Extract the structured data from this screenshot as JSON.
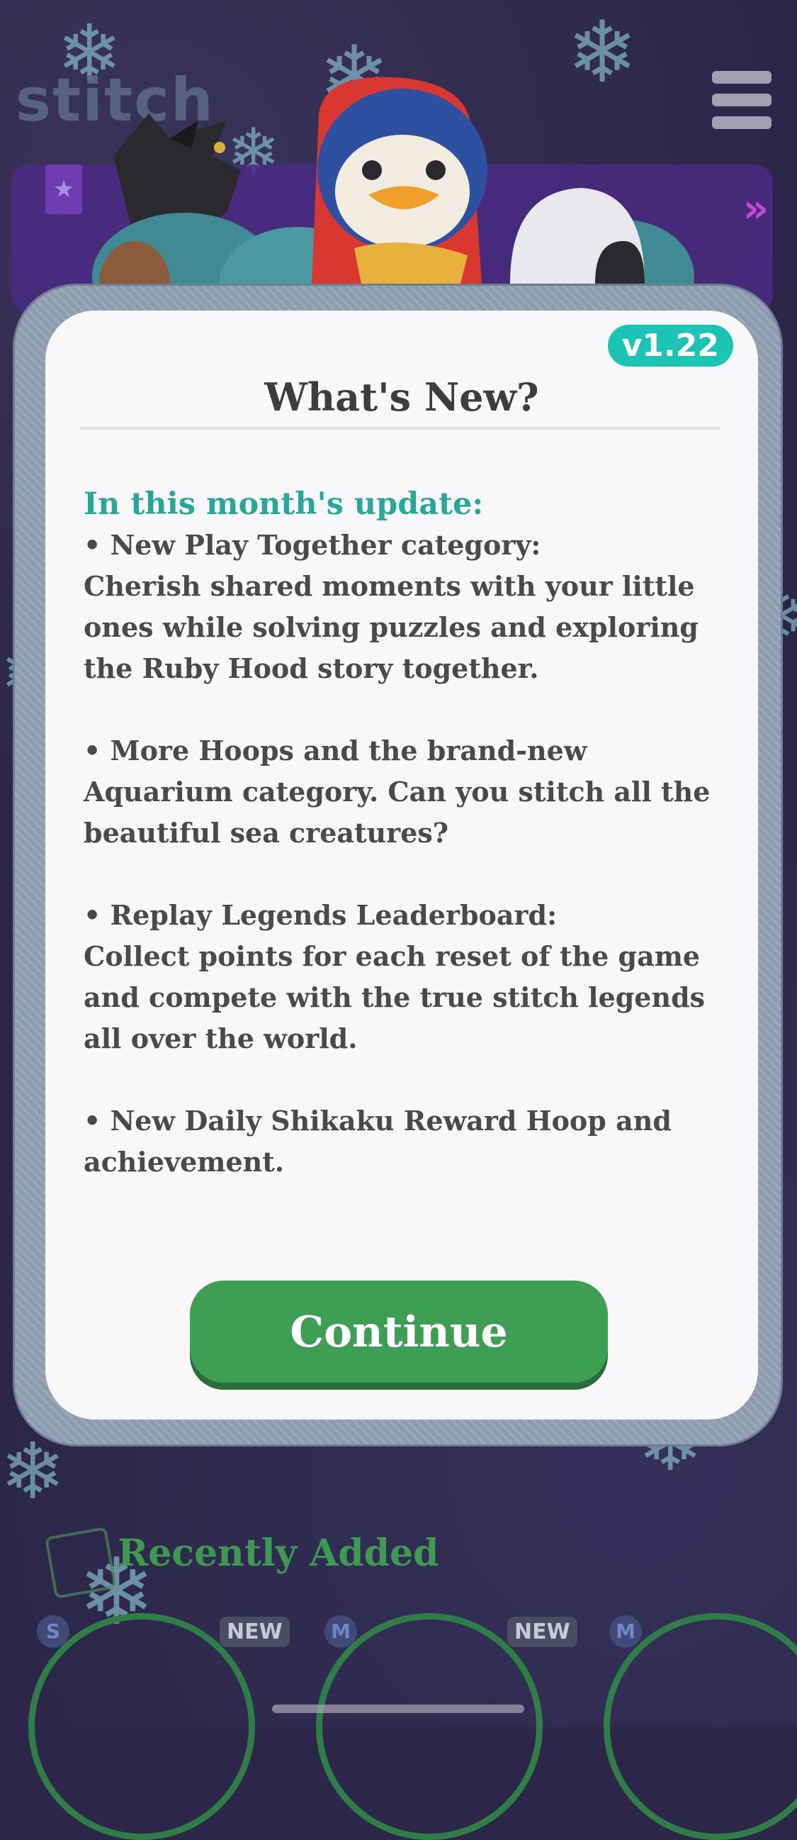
{
  "app": {
    "logo_text": "stitch"
  },
  "dialog": {
    "version_badge": "v1.22",
    "title": "What's New?",
    "subtitle": "In this month's update:",
    "paragraphs": [
      "• New Play Together category:\nCherish shared moments with your little ones while solving puzzles and exploring the Ruby Hood story together.",
      "• More Hoops and the brand-new Aquarium category. Can you stitch all the beautiful sea creatures?",
      "• Replay Legends Leaderboard:\nCollect points for each reset of the game and compete with the true stitch legends all over the world.",
      "• New Daily Shikaku Reward Hoop and achievement."
    ],
    "continue_label": "Continue"
  },
  "background": {
    "section_title": "Recently Added",
    "badges": [
      "NEW",
      "NEW"
    ],
    "size_labels": [
      "S",
      "M",
      "M"
    ]
  },
  "icons": {
    "menu": "hamburger-menu-icon",
    "snowflake": "snowflake-icon",
    "next": "double-chevron-icon"
  },
  "colors": {
    "accent_teal": "#1bc4b4",
    "button_green": "#3c9f53",
    "subtitle_teal": "#28a89b",
    "background": "#2b2647"
  }
}
